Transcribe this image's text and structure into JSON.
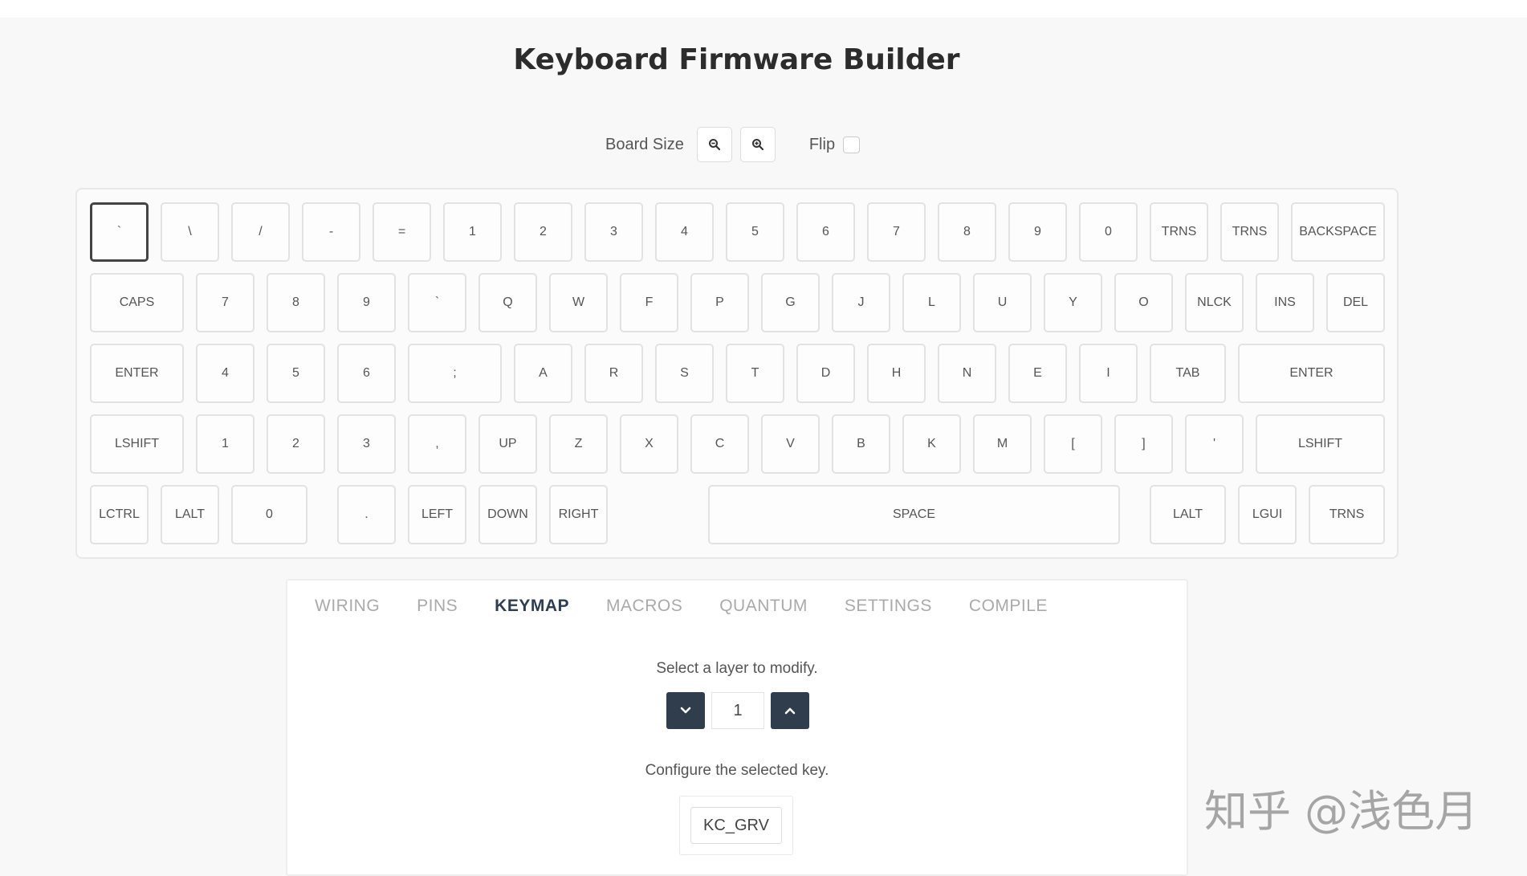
{
  "page": {
    "title": "Keyboard Firmware Builder"
  },
  "controls": {
    "board_size_label": "Board Size",
    "zoom_out_icon": "zoom-out-icon",
    "zoom_in_icon": "zoom-in-icon",
    "flip_label": "Flip",
    "flip_checked": false
  },
  "keyboard": {
    "selected_key": "`",
    "rows": [
      [
        "`",
        "\\",
        "/",
        "-",
        "=",
        "1",
        "2",
        "3",
        "4",
        "5",
        "6",
        "7",
        "8",
        "9",
        "0",
        "TRNS",
        "TRNS",
        "BACKSPACE"
      ],
      [
        "CAPS",
        "7",
        "8",
        "9",
        "`",
        "Q",
        "W",
        "F",
        "P",
        "G",
        "J",
        "L",
        "U",
        "Y",
        "O",
        "NLCK",
        "INS",
        "DEL"
      ],
      [
        "ENTER",
        "4",
        "5",
        "6",
        ";",
        "A",
        "R",
        "S",
        "T",
        "D",
        "H",
        "N",
        "E",
        "I",
        "TAB",
        "ENTER"
      ],
      [
        "LSHIFT",
        "1",
        "2",
        "3",
        ",",
        "UP",
        "Z",
        "X",
        "C",
        "V",
        "B",
        "K",
        "M",
        "[",
        "]",
        "'",
        "LSHIFT"
      ],
      [
        "LCTRL",
        "LALT",
        "0",
        ".",
        "LEFT",
        "DOWN",
        "RIGHT",
        "SPACE",
        "LALT",
        "LGUI",
        "TRNS"
      ]
    ]
  },
  "tabs": [
    {
      "label": "WIRING",
      "active": false
    },
    {
      "label": "PINS",
      "active": false
    },
    {
      "label": "KEYMAP",
      "active": true
    },
    {
      "label": "MACROS",
      "active": false
    },
    {
      "label": "QUANTUM",
      "active": false
    },
    {
      "label": "SETTINGS",
      "active": false
    },
    {
      "label": "COMPILE",
      "active": false
    }
  ],
  "keymap": {
    "layer_prompt": "Select a layer to modify.",
    "layer_value": "1",
    "configure_prompt": "Configure the selected key.",
    "keycode": "KC_GRV"
  },
  "watermark": "知乎 @浅色月",
  "colors": {
    "accent": "#2f3d4c",
    "background": "#f8f8f8"
  }
}
